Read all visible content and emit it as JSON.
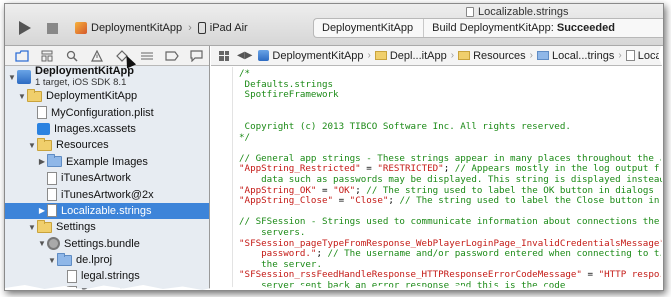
{
  "window": {
    "title": "Localizable.strings"
  },
  "toolbar": {
    "run_label": "Run",
    "stop_label": "Stop",
    "scheme": "DeploymentKitApp",
    "destination": "iPad Air",
    "activity_scheme": "DeploymentKitApp",
    "activity_status_prefix": "Build DeploymentKitApp:",
    "activity_status_value": "Succeeded"
  },
  "navigator": {
    "tabs": [
      "project-navigator",
      "symbol-navigator",
      "find-navigator",
      "issue-navigator",
      "test-navigator",
      "debug-navigator",
      "breakpoint-navigator",
      "log-navigator"
    ],
    "project": {
      "name": "DeploymentKitApp",
      "subtitle": "1 target, iOS SDK 8.1"
    },
    "items": [
      {
        "label": "DeploymentKitApp",
        "type": "folder",
        "depth": 1,
        "disclosure": "open"
      },
      {
        "label": "MyConfiguration.plist",
        "type": "doc",
        "depth": 2,
        "disclosure": ""
      },
      {
        "label": "Images.xcassets",
        "type": "assets",
        "depth": 2,
        "disclosure": ""
      },
      {
        "label": "Resources",
        "type": "folder",
        "depth": 2,
        "disclosure": "open"
      },
      {
        "label": "Example Images",
        "type": "folder-blue",
        "depth": 3,
        "disclosure": "closed"
      },
      {
        "label": "iTunesArtwork",
        "type": "doc",
        "depth": 3,
        "disclosure": ""
      },
      {
        "label": "iTunesArtwork@2x",
        "type": "doc",
        "depth": 3,
        "disclosure": ""
      },
      {
        "label": "Localizable.strings",
        "type": "doc",
        "depth": 3,
        "disclosure": "closed",
        "selected": true
      },
      {
        "label": "Settings",
        "type": "folder",
        "depth": 2,
        "disclosure": "open"
      },
      {
        "label": "Settings.bundle",
        "type": "bundle",
        "depth": 3,
        "disclosure": "open"
      },
      {
        "label": "de.lproj",
        "type": "folder-blue",
        "depth": 4,
        "disclosure": "open"
      },
      {
        "label": "legal.strings",
        "type": "doc",
        "depth": 5,
        "disclosure": ""
      },
      {
        "label": "Root.strings",
        "type": "doc",
        "depth": 5,
        "disclosure": ""
      }
    ]
  },
  "jumpbar": {
    "items": [
      {
        "label": "DeploymentKitApp",
        "icon": "project"
      },
      {
        "label": "Depl...itApp",
        "icon": "folder"
      },
      {
        "label": "Resources",
        "icon": "folder"
      },
      {
        "label": "Local...trings",
        "icon": "folder-blue"
      },
      {
        "label": "Locali...",
        "icon": "doc"
      }
    ]
  },
  "code": {
    "lines": [
      [
        {
          "t": "/*",
          "c": "comment"
        }
      ],
      [
        {
          "t": " Defaults.strings",
          "c": "comment"
        }
      ],
      [
        {
          "t": " SpotfireFramework",
          "c": "comment"
        }
      ],
      [
        {
          "t": "",
          "c": "plain"
        }
      ],
      [
        {
          "t": "",
          "c": "plain"
        }
      ],
      [
        {
          "t": " Copyright (c) 2013 TIBCO Software Inc. All rights reserved.",
          "c": "comment"
        }
      ],
      [
        {
          "t": "*/",
          "c": "comment"
        }
      ],
      [
        {
          "t": "",
          "c": "plain"
        }
      ],
      [
        {
          "t": "// General app strings - These strings appear in many places throughout the app",
          "c": "comment"
        }
      ],
      [
        {
          "t": "\"AppString_Restricted\"",
          "c": "string"
        },
        {
          "t": " = ",
          "c": "plain"
        },
        {
          "t": "\"RESTRICTED\"",
          "c": "string"
        },
        {
          "t": "; ",
          "c": "plain"
        },
        {
          "t": "// Appears mostly in the log output from",
          "c": "comment"
        }
      ],
      [
        {
          "t": "    data such as passwords may be displayed. This string is displayed instead of",
          "c": "comment"
        }
      ],
      [
        {
          "t": "\"AppString_OK\"",
          "c": "string"
        },
        {
          "t": " = ",
          "c": "plain"
        },
        {
          "t": "\"OK\"",
          "c": "string"
        },
        {
          "t": "; ",
          "c": "plain"
        },
        {
          "t": "// The string used to label the OK button in dialogs and",
          "c": "comment"
        }
      ],
      [
        {
          "t": "\"AppString_Close\"",
          "c": "string"
        },
        {
          "t": " = ",
          "c": "plain"
        },
        {
          "t": "\"Close\"",
          "c": "string"
        },
        {
          "t": "; ",
          "c": "plain"
        },
        {
          "t": "// The string used to label the Close button in dia",
          "c": "comment"
        }
      ],
      [
        {
          "t": "",
          "c": "plain"
        }
      ],
      [
        {
          "t": "// SFSession - Strings used to communicate information about connections the app",
          "c": "comment"
        }
      ],
      [
        {
          "t": "    servers.",
          "c": "comment"
        }
      ],
      [
        {
          "t": "\"SFSession_pageTypeFromResponse_WebPlayerLoginPage_InvalidCredentialsMessage\"",
          "c": "string"
        },
        {
          "t": " = ",
          "c": "plain"
        }
      ],
      [
        {
          "t": "    password.\"",
          "c": "string"
        },
        {
          "t": "; ",
          "c": "plain"
        },
        {
          "t": "// The username and/or password entered when connecting to the S",
          "c": "comment"
        }
      ],
      [
        {
          "t": "    the server.",
          "c": "comment"
        }
      ],
      [
        {
          "t": "\"SFSession_rssFeedHandleResponse_HTTPResponseErrorCodeMessage\"",
          "c": "string"
        },
        {
          "t": " = ",
          "c": "plain"
        },
        {
          "t": "\"HTTP response",
          "c": "string"
        }
      ],
      [
        {
          "t": "    server sent back an error response and this is the code ",
          "c": "comment"
        }
      ]
    ]
  }
}
